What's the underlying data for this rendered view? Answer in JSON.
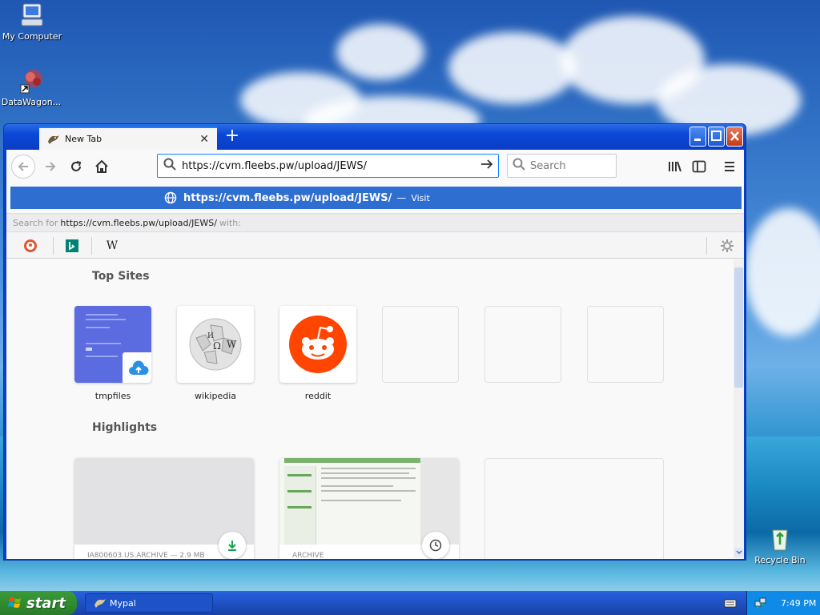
{
  "desktop": {
    "icons": [
      {
        "label": "My Computer"
      },
      {
        "label": "DataWagon..."
      },
      {
        "label": "Recycle Bin"
      }
    ]
  },
  "browser": {
    "tab": {
      "title": "New Tab",
      "close": "✕"
    },
    "newtab": "+",
    "window_controls": {
      "minimize": "_",
      "maximize": "□",
      "close": "✕"
    },
    "url": "https://cvm.fleebs.pw/upload/JEWS/",
    "search_placeholder": "Search",
    "suggestion": {
      "url": "https://cvm.fleebs.pw/upload/JEWS/",
      "separator": "—",
      "action": "Visit"
    },
    "search_with": {
      "prefix": "Search for",
      "url": "https://cvm.fleebs.pw/upload/JEWS/",
      "suffix": "with:"
    },
    "engines": [
      {
        "name": "duckduckgo-icon"
      },
      {
        "name": "bing-icon"
      },
      {
        "name": "wikipedia-icon",
        "glyph": "W"
      }
    ]
  },
  "newtab_page": {
    "top_sites_title": "Top Sites",
    "top_sites": [
      {
        "label": "tmpfiles"
      },
      {
        "label": "wikipedia"
      },
      {
        "label": "reddit"
      },
      {
        "label": ""
      },
      {
        "label": ""
      },
      {
        "label": ""
      }
    ],
    "highlights_title": "Highlights",
    "highlights": [
      {
        "meta": "IA800603.US.ARCHIVE — 2.9 MB"
      },
      {
        "meta": "ARCHIVE"
      }
    ]
  },
  "taskbar": {
    "start_label": "start",
    "task_item": "Mypal",
    "clock": "7:49 PM"
  },
  "colors": {
    "accent": "#0a84ff",
    "suggest_bg": "#2e6ed1",
    "reddit": "#ff4500",
    "tmpfiles": "#5b6be0"
  }
}
